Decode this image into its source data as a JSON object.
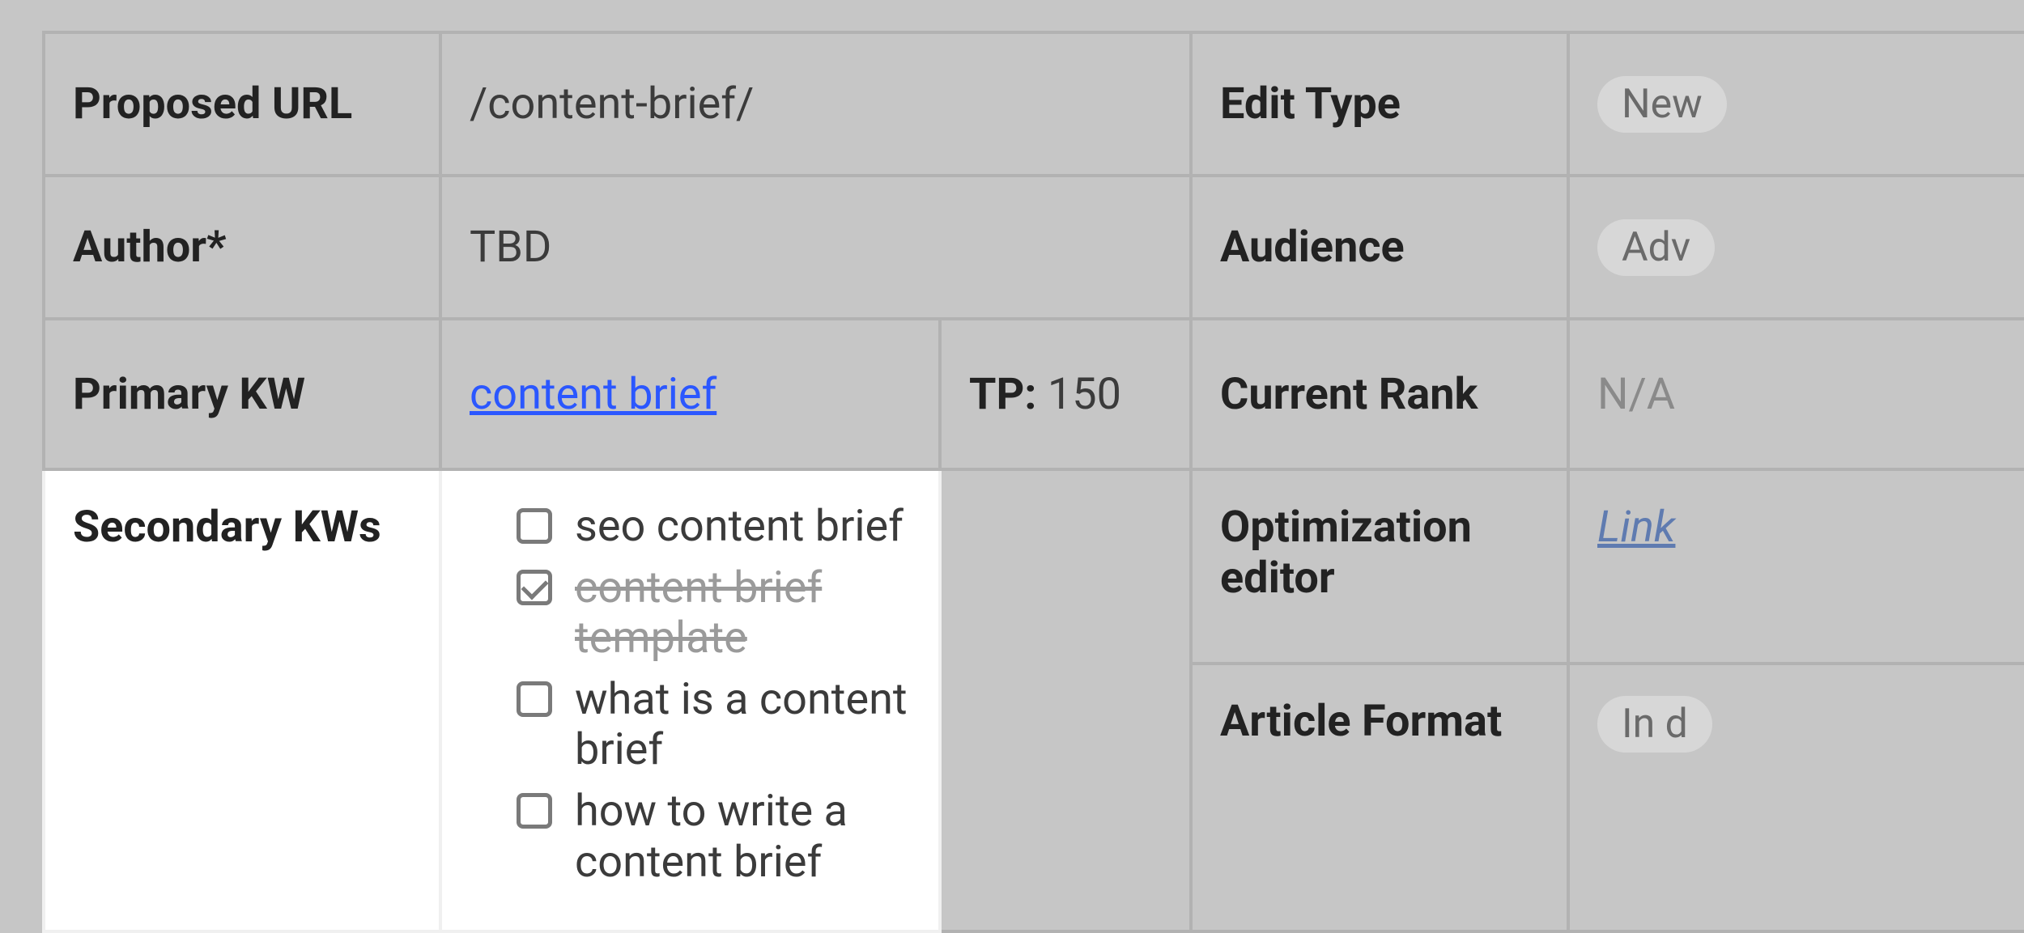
{
  "rows": {
    "proposed_url": {
      "label": "Proposed URL",
      "value": "/content-brief/"
    },
    "edit_type": {
      "label": "Edit Type",
      "value": "New"
    },
    "author": {
      "label": "Author*",
      "value": "TBD"
    },
    "audience": {
      "label": "Audience",
      "value": "Adv"
    },
    "primary_kw": {
      "label": "Primary KW",
      "link_text": "content brief",
      "tp_label": "TP:",
      "tp_value": "150"
    },
    "current_rank": {
      "label": "Current Rank",
      "value": "N/A"
    },
    "secondary_kws": {
      "label": "Secondary KWs",
      "items": [
        {
          "text": "seo content brief",
          "checked": false,
          "struck": false
        },
        {
          "text": "content brief template",
          "checked": true,
          "struck": true
        },
        {
          "text": "what is a content brief",
          "checked": false,
          "struck": false
        },
        {
          "text": "how to write a content brief",
          "checked": false,
          "struck": false
        }
      ]
    },
    "optimization_editor": {
      "label": "Optimization editor",
      "link_text": "Link"
    },
    "article_format": {
      "label": "Article Format",
      "value": "In d"
    }
  }
}
